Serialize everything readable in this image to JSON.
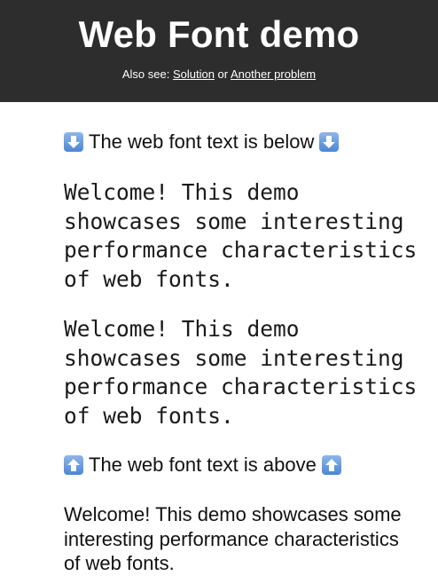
{
  "header": {
    "title": "Web Font demo",
    "also_see_prefix": "Also see: ",
    "link_solution": "Solution",
    "joiner": " or ",
    "link_another": "Another problem"
  },
  "main": {
    "marker_below": "The web font text is below",
    "paragraph_1": "Welcome! This demo showcases some interesting performance characteristics of web fonts.",
    "paragraph_2": "Welcome! This demo showcases some interesting performance characteristics of web fonts.",
    "marker_above": "The web font text is above",
    "paragraph_3": "Welcome! This demo showcases some interesting performance characteristics of web fonts."
  },
  "icons": {
    "down": "down-arrow-icon",
    "up": "up-arrow-icon"
  },
  "colors": {
    "header_bg": "#2d2d2d",
    "arrow_blue": "#4a86d6"
  }
}
